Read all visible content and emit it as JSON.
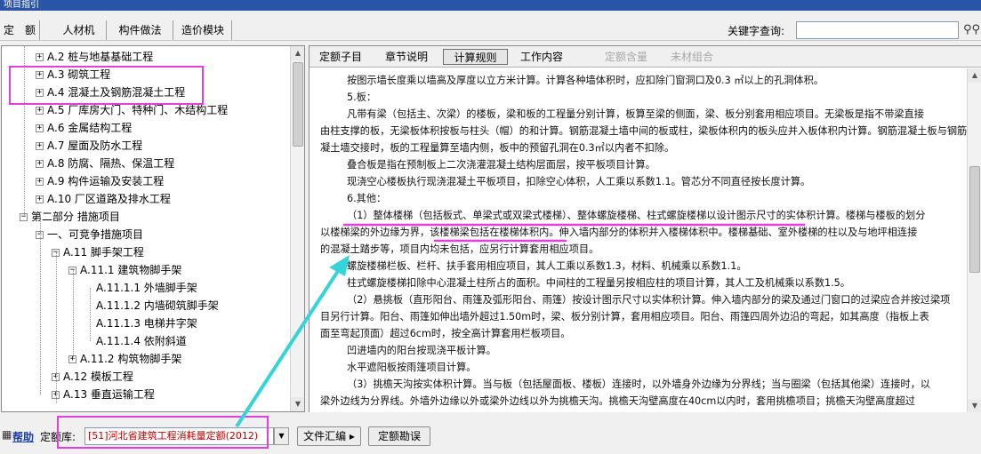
{
  "window": {
    "title": "项目指引"
  },
  "topbar": {
    "tabs": [
      "定　额",
      "人材机",
      "构件做法",
      "造价模块"
    ],
    "search_label": "关键字查询:",
    "search_value": "",
    "search_icon": "binoculars-icon"
  },
  "tree": {
    "items": [
      {
        "toggle": "+",
        "label": "A.2 桩与地基基础工程"
      },
      {
        "toggle": "+",
        "label": "A.3 砌筑工程"
      },
      {
        "toggle": "+",
        "label": "A.4 混凝土及钢筋混凝土工程"
      },
      {
        "toggle": "+",
        "label": "A.5 厂库房大门、特种门、木结构工程"
      },
      {
        "toggle": "+",
        "label": "A.6 金属结构工程"
      },
      {
        "toggle": "+",
        "label": "A.7 屋面及防水工程"
      },
      {
        "toggle": "+",
        "label": "A.8 防腐、隔热、保温工程"
      },
      {
        "toggle": "+",
        "label": "A.9 构件运输及安装工程"
      },
      {
        "toggle": "+",
        "label": "A.10 厂区道路及排水工程"
      },
      {
        "toggle": "−",
        "label": "第二部分 措施项目"
      },
      {
        "toggle": "−",
        "label": "一、可竞争措施项目"
      },
      {
        "toggle": "−",
        "label": "A.11 脚手架工程"
      },
      {
        "toggle": "−",
        "label": "A.11.1 建筑物脚手架"
      },
      {
        "toggle": "",
        "label": "A.11.1.1 外墙脚手架"
      },
      {
        "toggle": "",
        "label": "A.11.1.2 内墙砌筑脚手架"
      },
      {
        "toggle": "",
        "label": "A.11.1.3 电梯井字架"
      },
      {
        "toggle": "",
        "label": "A.11.1.4 依附斜道"
      },
      {
        "toggle": "+",
        "label": "A.11.2 构筑物脚手架"
      },
      {
        "toggle": "+",
        "label": "A.12 模板工程"
      },
      {
        "toggle": "+",
        "label": "A.13 垂直运输工程"
      }
    ]
  },
  "right_tabs": {
    "tabs": [
      "定额子目",
      "章节说明",
      "计算规则",
      "工作内容",
      "定额含量",
      "未材组合"
    ],
    "active": "计算规则"
  },
  "content": {
    "lines": [
      "按图示墙长度乘以墙高及厚度以立方米计算。计算各种墙体积时，应扣除门窗洞口及0.3 ㎡以上的孔洞体积。",
      "5.板：",
      "凡带有梁（包括主、次梁）的楼板，梁和板的工程量分别计算，板算至梁的侧面，梁、板分别套用相应项目。无梁板是指不带梁直接",
      "由柱支撑的板，无梁板体积按板与柱头（帽）的和计算。钢筋混凝土墙中间的板或柱，梁板体积内的板头应并入板体积内计算。钢筋混凝土板与钢筋混",
      "凝土墙交接时，板的工程量算至墙内侧，板中的预留孔洞在0.3㎡以内者不扣除。",
      "叠合板是指在预制板上二次浇灌混凝土结构层面层，按平板项目计算。",
      "现浇空心楼板执行现浇混凝土平板项目，扣除空心体积，人工乘以系数1.1。管芯分不同直径按长度计算。",
      "6.其他：",
      "（1）整体楼梯（包括板式、单梁式或双梁式楼梯）、整体螺旋楼梯、柱式螺旋楼梯以设计图示尺寸的实体积计算。楼梯与楼板的划分",
      "以楼梯梁的外边缘为界，该楼梯梁包括在楼梯体积内。伸入墙内部分的体积并入楼梯体积中。楼梯基础、室外楼梯的柱以及与地坪相连接",
      "的混凝土踏步等，项目内均未包括，应另行计算套用相应项目。",
      "螺旋楼梯栏板、栏杆、扶手套用相应项目，其人工乘以系数1.3，材料、机械乘以系数1.1。",
      "柱式螺旋楼梯扣除中心混凝土柱所占的面积。中间柱的工程量另按相应柱的项目计算，其人工及机械乘以系数1.5。",
      "（2）悬挑板（直形阳台、雨篷及弧形阳台、雨篷）按设计图示尺寸以实体积计算。伸入墙内部分的梁及通过门窗口的过梁应合并按过梁项",
      "目另行计算。阳台、雨篷如伸出墙外超过1.50m时，梁、板分别计算，套用相应项目。阳台、雨篷四周外边沿的弯起，如其高度（指板上表",
      "面至弯起顶面）超过6cm时，按全高计算套用栏板项目。",
      "凹进墙内的阳台按现浇平板计算。",
      "水平遮阳板按雨篷项目计算。",
      "（3）挑檐天沟按实体积计算。当与板（包括屋面板、楼板）连接时，以外墙身外边缘为分界线；当与圈梁（包括其他梁）连接时，以",
      "梁外边线为分界线。外墙外边缘以外或梁外边线以外为挑檐天沟。挑檐天沟壁高度在40cm以内时，套用挑檐项目；挑檐天沟壁高度超过"
    ]
  },
  "bottom": {
    "help_label": "帮助",
    "library_label": "定额库:",
    "library_value": "[51]河北省建筑工程消耗量定额(2012)",
    "file_button": "文件汇编 ▸",
    "errata_button": "定额勘误"
  },
  "colors": {
    "highlight": "#e23ee0",
    "arrow": "#35d4d8",
    "link": "#1a3fb0",
    "combo_text": "#c00000"
  }
}
